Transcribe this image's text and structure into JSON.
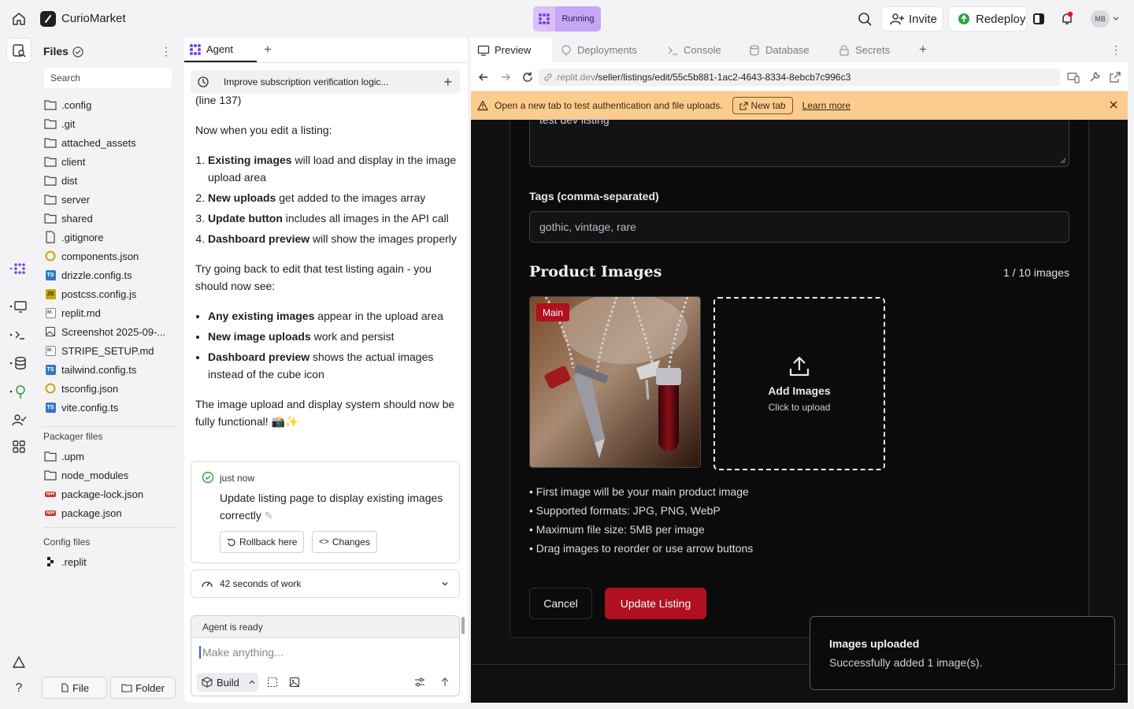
{
  "app": {
    "name": "CurioMarket",
    "status": "Running"
  },
  "topbar": {
    "invite_label": "Invite",
    "redeploy_label": "Redeploy",
    "avatar_initials": "MB"
  },
  "files": {
    "title": "Files",
    "search_placeholder": "Search",
    "items": [
      ".config",
      ".git",
      "attached_assets",
      "client",
      "dist",
      "server",
      "shared",
      ".gitignore",
      "components.json",
      "drizzle.config.ts",
      "postcss.config.js",
      "replit.md",
      "Screenshot 2025-09-...",
      "STRIPE_SETUP.md",
      "tailwind.config.ts",
      "tsconfig.json",
      "vite.config.ts"
    ],
    "packager_title": "Packager files",
    "packager_items": [
      ".upm",
      "node_modules",
      "package-lock.json",
      "package.json"
    ],
    "config_title": "Config files",
    "config_items": [
      ".replit"
    ],
    "file_button": "File",
    "folder_button": "Folder"
  },
  "agent": {
    "tab_label": "Agent",
    "thread_title": "Improve subscription verification logic...",
    "chat": {
      "line_ref": "(line 137)",
      "intro": "Now when you edit a listing:",
      "ordered": [
        {
          "bold": "Existing images",
          "rest": " will load and display in the image upload area"
        },
        {
          "bold": "New uploads",
          "rest": " get added to the images array"
        },
        {
          "bold": "Update button",
          "rest": " includes all images in the API call"
        },
        {
          "bold": "Dashboard preview",
          "rest": " will show the images properly"
        }
      ],
      "try_again": "Try going back to edit that test listing again - you should now see:",
      "bullets": [
        {
          "bold": "Any existing images",
          "rest": " appear in the upload area"
        },
        {
          "bold": "New image uploads",
          "rest": " work and persist"
        },
        {
          "bold": "Dashboard preview",
          "rest": " shows the actual images instead of the cube icon"
        }
      ],
      "closing": "The image upload and display system should now be fully functional! 📸✨"
    },
    "checkpoint": {
      "time": "just now",
      "message": "Update listing page to display existing images correctly",
      "rollback_label": "Rollback here",
      "changes_label": "Changes"
    },
    "work_summary": "42 seconds of work",
    "status": "Agent is ready",
    "input_placeholder": "Make anything...",
    "build_label": "Build"
  },
  "preview": {
    "tabs": [
      "Preview",
      "Deployments",
      "Console",
      "Database",
      "Secrets"
    ],
    "url_host": ".replit.dev",
    "url_path": "/seller/listings/edit/55c5b881-1ac2-4643-8334-8ebcb7c996c3",
    "banner_text": "Open a new tab to test authentication and file uploads.",
    "banner_newtab": "New tab",
    "banner_learn": "Learn more",
    "form": {
      "description_value": "test dev listing",
      "tags_label": "Tags (comma-separated)",
      "tags_value": "gothic, vintage, rare",
      "images_title": "Product Images",
      "images_count": "1 / 10 images",
      "main_badge": "Main",
      "add_title": "Add Images",
      "add_sub": "Click to upload",
      "notes": [
        "• First image will be your main product image",
        "• Supported formats: JPG, PNG, WebP",
        "• Maximum file size: 5MB per image",
        "• Drag images to reorder or use arrow buttons"
      ],
      "cancel_label": "Cancel",
      "update_label": "Update Listing"
    },
    "toast": {
      "title": "Images uploaded",
      "message": "Successfully added 1 image(s)."
    }
  },
  "colors": {
    "accent": "#b0101f",
    "banner": "#fccb8e",
    "running": "#c7a6f5"
  }
}
